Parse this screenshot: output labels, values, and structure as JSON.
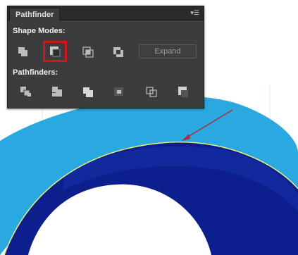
{
  "panel": {
    "tab_label": "Pathfinder",
    "menu_icon": "panel-menu-icon",
    "shape_modes_label": "Shape Modes:",
    "pathfinders_label": "Pathfinders:",
    "expand_label": "Expand",
    "shape_mode_buttons": [
      "unite-icon",
      "minus-front-icon",
      "intersect-icon",
      "exclude-icon"
    ],
    "pathfinder_buttons": [
      "divide-icon",
      "trim-icon",
      "merge-icon",
      "crop-icon",
      "outline-icon",
      "minus-back-icon"
    ],
    "selected_button": "minus-front-icon"
  },
  "colors": {
    "panel_bg": "#3c3c3c",
    "highlight": "#d0151f",
    "light_blue_shape": "#29a9df",
    "dark_blue_shape": "#0c1f8c",
    "arrow": "#b02a3a"
  }
}
